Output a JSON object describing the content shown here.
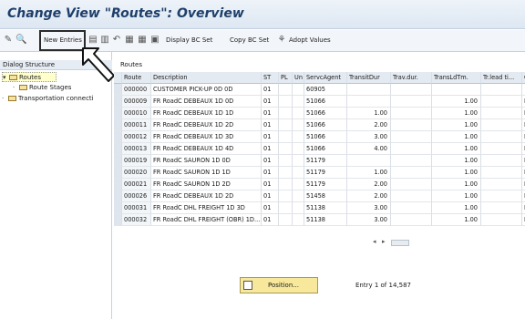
{
  "window": {
    "title": "Change View \"Routes\": Overview"
  },
  "toolbar": {
    "new_entries": "New Entries",
    "display_bc_set": "Display BC Set",
    "copy_bc_set": "Copy BC Set",
    "adopt_values": "Adopt Values"
  },
  "left_pane": {
    "header": "Dialog Structure",
    "items": [
      {
        "label": "Routes"
      },
      {
        "label": "Route Stages"
      },
      {
        "label": "Transportation connecti"
      }
    ]
  },
  "table": {
    "title": "Routes",
    "columns": [
      "Route",
      "Description",
      "ST",
      "PL",
      "Un",
      "ServcAgent",
      "TransitDur",
      "Trav.dur.",
      "TransLdTm.",
      "Tr.lead ti...",
      "Ca"
    ],
    "rows": [
      [
        "000000",
        "CUSTOMER PICK-UP 0D 0D",
        "01",
        "",
        "",
        "60905",
        "",
        "",
        "",
        "",
        ""
      ],
      [
        "000009",
        "FR RoadC DEBEAUX 1D 0D",
        "01",
        "",
        "",
        "51066",
        "",
        "",
        "1.00",
        "",
        "FR"
      ],
      [
        "000010",
        "FR RoadC DEBEAUX 1D 1D",
        "01",
        "",
        "",
        "51066",
        "1.00",
        "",
        "1.00",
        "",
        "FR"
      ],
      [
        "000011",
        "FR RoadC DEBEAUX 1D 2D",
        "01",
        "",
        "",
        "51066",
        "2.00",
        "",
        "1.00",
        "",
        "FR"
      ],
      [
        "000012",
        "FR RoadC DEBEAUX 1D 3D",
        "01",
        "",
        "",
        "51066",
        "3.00",
        "",
        "1.00",
        "",
        "FR"
      ],
      [
        "000013",
        "FR RoadC DEBEAUX 1D 4D",
        "01",
        "",
        "",
        "51066",
        "4.00",
        "",
        "1.00",
        "",
        "FR"
      ],
      [
        "000019",
        "FR RoadC SAURON 1D 0D",
        "01",
        "",
        "",
        "51179",
        "",
        "",
        "1.00",
        "",
        "FR"
      ],
      [
        "000020",
        "FR RoadC SAURON 1D 1D",
        "01",
        "",
        "",
        "51179",
        "1.00",
        "",
        "1.00",
        "",
        "FR"
      ],
      [
        "000021",
        "FR RoadC SAURON 1D 2D",
        "01",
        "",
        "",
        "51179",
        "2.00",
        "",
        "1.00",
        "",
        "FR"
      ],
      [
        "000026",
        "FR RoadC DEBEAUX 1D 2D",
        "01",
        "",
        "",
        "51458",
        "2.00",
        "",
        "1.00",
        "",
        "FR"
      ],
      [
        "000031",
        "FR RoadC DHL FREIGHT 1D 3D",
        "01",
        "",
        "",
        "51138",
        "3.00",
        "",
        "1.00",
        "",
        "FR"
      ],
      [
        "000032",
        "FR RoadC DHL FREIGHT (OBR) 1D...",
        "01",
        "",
        "",
        "51138",
        "3.00",
        "",
        "1.00",
        "",
        "FR"
      ]
    ]
  },
  "footer": {
    "position_button": "Position...",
    "entry_count": "Entry 1 of 14,587"
  },
  "colors": {
    "title": "#1e3f6b",
    "position_button": "#f7e89c",
    "tree_selected": "#ffffcc"
  }
}
